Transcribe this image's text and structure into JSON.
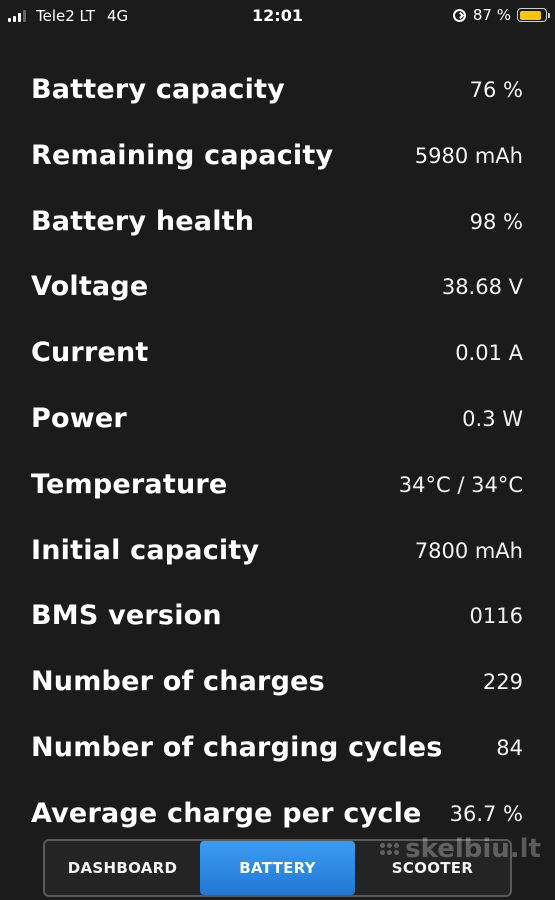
{
  "status_bar": {
    "carrier": "Tele2 LT",
    "network": "4G",
    "time": "12:01",
    "battery_percent_text": "87 %",
    "battery_level": 0.87,
    "battery_color": "#f7c600"
  },
  "battery_info": {
    "rows": [
      {
        "label": "Battery capacity",
        "value": "76 %"
      },
      {
        "label": "Remaining capacity",
        "value": "5980 mAh"
      },
      {
        "label": "Battery health",
        "value": "98 %"
      },
      {
        "label": "Voltage",
        "value": "38.68 V"
      },
      {
        "label": "Current",
        "value": "0.01 A"
      },
      {
        "label": "Power",
        "value": "0.3 W"
      },
      {
        "label": "Temperature",
        "value": "34°C / 34°C"
      },
      {
        "label": "Initial capacity",
        "value": "7800 mAh"
      },
      {
        "label": "BMS version",
        "value": "0116"
      },
      {
        "label": "Number of charges",
        "value": "229"
      },
      {
        "label": "Number of charging cycles",
        "value": "84"
      },
      {
        "label": "Average charge per cycle",
        "value": "36.7 %"
      }
    ]
  },
  "tabs": [
    {
      "label": "DASHBOARD",
      "active": false
    },
    {
      "label": "BATTERY",
      "active": true
    },
    {
      "label": "SCOOTER",
      "active": false
    }
  ],
  "accent_color": "#2a8ae6",
  "watermark": "skelbiu.lt"
}
